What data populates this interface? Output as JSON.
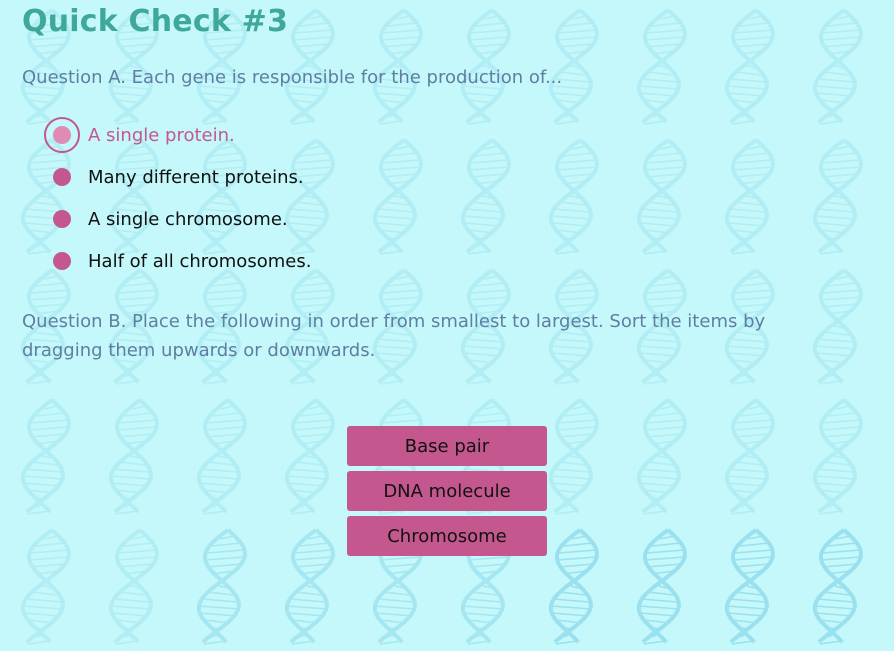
{
  "quiz": {
    "title": "Quick Check #3",
    "question_a": {
      "text": "Question A. Each gene is responsible for the production of...",
      "options": [
        {
          "label": "A single protein.",
          "selected": true
        },
        {
          "label": "Many different proteins.",
          "selected": false
        },
        {
          "label": "A single chromosome.",
          "selected": false
        },
        {
          "label": "Half of all chromosomes.",
          "selected": false
        }
      ]
    },
    "question_b": {
      "text": "Question B. Place the following in order from smallest to largest. Sort the items by dragging them upwards or downwards.",
      "items": [
        "Base pair",
        "DNA molecule",
        "Chromosome"
      ]
    }
  },
  "colors": {
    "background": "#c4f8fa",
    "title": "#3ea89a",
    "question_text": "#5f7ea1",
    "accent": "#c5578f",
    "selected_dot": "#df8bb4",
    "dna_pattern": "#8ed9ea"
  },
  "icons": {
    "background_pattern": "dna-helix-icon",
    "radio": "radio-dot-icon"
  }
}
